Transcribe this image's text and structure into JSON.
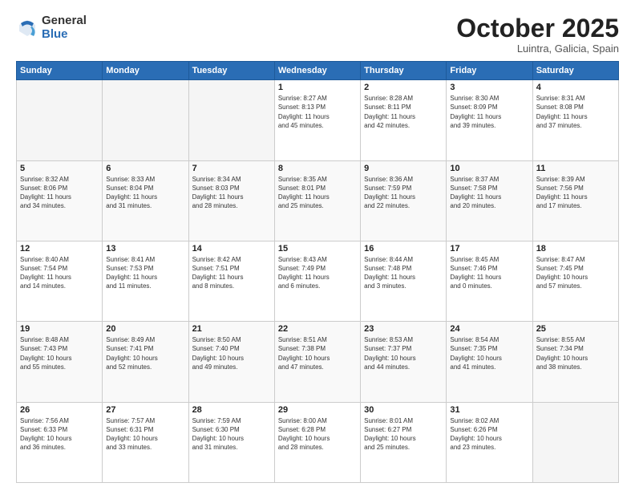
{
  "header": {
    "logo_general": "General",
    "logo_blue": "Blue",
    "month_title": "October 2025",
    "location": "Luintra, Galicia, Spain"
  },
  "weekdays": [
    "Sunday",
    "Monday",
    "Tuesday",
    "Wednesday",
    "Thursday",
    "Friday",
    "Saturday"
  ],
  "weeks": [
    [
      {
        "day": "",
        "info": ""
      },
      {
        "day": "",
        "info": ""
      },
      {
        "day": "",
        "info": ""
      },
      {
        "day": "1",
        "info": "Sunrise: 8:27 AM\nSunset: 8:13 PM\nDaylight: 11 hours\nand 45 minutes."
      },
      {
        "day": "2",
        "info": "Sunrise: 8:28 AM\nSunset: 8:11 PM\nDaylight: 11 hours\nand 42 minutes."
      },
      {
        "day": "3",
        "info": "Sunrise: 8:30 AM\nSunset: 8:09 PM\nDaylight: 11 hours\nand 39 minutes."
      },
      {
        "day": "4",
        "info": "Sunrise: 8:31 AM\nSunset: 8:08 PM\nDaylight: 11 hours\nand 37 minutes."
      }
    ],
    [
      {
        "day": "5",
        "info": "Sunrise: 8:32 AM\nSunset: 8:06 PM\nDaylight: 11 hours\nand 34 minutes."
      },
      {
        "day": "6",
        "info": "Sunrise: 8:33 AM\nSunset: 8:04 PM\nDaylight: 11 hours\nand 31 minutes."
      },
      {
        "day": "7",
        "info": "Sunrise: 8:34 AM\nSunset: 8:03 PM\nDaylight: 11 hours\nand 28 minutes."
      },
      {
        "day": "8",
        "info": "Sunrise: 8:35 AM\nSunset: 8:01 PM\nDaylight: 11 hours\nand 25 minutes."
      },
      {
        "day": "9",
        "info": "Sunrise: 8:36 AM\nSunset: 7:59 PM\nDaylight: 11 hours\nand 22 minutes."
      },
      {
        "day": "10",
        "info": "Sunrise: 8:37 AM\nSunset: 7:58 PM\nDaylight: 11 hours\nand 20 minutes."
      },
      {
        "day": "11",
        "info": "Sunrise: 8:39 AM\nSunset: 7:56 PM\nDaylight: 11 hours\nand 17 minutes."
      }
    ],
    [
      {
        "day": "12",
        "info": "Sunrise: 8:40 AM\nSunset: 7:54 PM\nDaylight: 11 hours\nand 14 minutes."
      },
      {
        "day": "13",
        "info": "Sunrise: 8:41 AM\nSunset: 7:53 PM\nDaylight: 11 hours\nand 11 minutes."
      },
      {
        "day": "14",
        "info": "Sunrise: 8:42 AM\nSunset: 7:51 PM\nDaylight: 11 hours\nand 8 minutes."
      },
      {
        "day": "15",
        "info": "Sunrise: 8:43 AM\nSunset: 7:49 PM\nDaylight: 11 hours\nand 6 minutes."
      },
      {
        "day": "16",
        "info": "Sunrise: 8:44 AM\nSunset: 7:48 PM\nDaylight: 11 hours\nand 3 minutes."
      },
      {
        "day": "17",
        "info": "Sunrise: 8:45 AM\nSunset: 7:46 PM\nDaylight: 11 hours\nand 0 minutes."
      },
      {
        "day": "18",
        "info": "Sunrise: 8:47 AM\nSunset: 7:45 PM\nDaylight: 10 hours\nand 57 minutes."
      }
    ],
    [
      {
        "day": "19",
        "info": "Sunrise: 8:48 AM\nSunset: 7:43 PM\nDaylight: 10 hours\nand 55 minutes."
      },
      {
        "day": "20",
        "info": "Sunrise: 8:49 AM\nSunset: 7:41 PM\nDaylight: 10 hours\nand 52 minutes."
      },
      {
        "day": "21",
        "info": "Sunrise: 8:50 AM\nSunset: 7:40 PM\nDaylight: 10 hours\nand 49 minutes."
      },
      {
        "day": "22",
        "info": "Sunrise: 8:51 AM\nSunset: 7:38 PM\nDaylight: 10 hours\nand 47 minutes."
      },
      {
        "day": "23",
        "info": "Sunrise: 8:53 AM\nSunset: 7:37 PM\nDaylight: 10 hours\nand 44 minutes."
      },
      {
        "day": "24",
        "info": "Sunrise: 8:54 AM\nSunset: 7:35 PM\nDaylight: 10 hours\nand 41 minutes."
      },
      {
        "day": "25",
        "info": "Sunrise: 8:55 AM\nSunset: 7:34 PM\nDaylight: 10 hours\nand 38 minutes."
      }
    ],
    [
      {
        "day": "26",
        "info": "Sunrise: 7:56 AM\nSunset: 6:33 PM\nDaylight: 10 hours\nand 36 minutes."
      },
      {
        "day": "27",
        "info": "Sunrise: 7:57 AM\nSunset: 6:31 PM\nDaylight: 10 hours\nand 33 minutes."
      },
      {
        "day": "28",
        "info": "Sunrise: 7:59 AM\nSunset: 6:30 PM\nDaylight: 10 hours\nand 31 minutes."
      },
      {
        "day": "29",
        "info": "Sunrise: 8:00 AM\nSunset: 6:28 PM\nDaylight: 10 hours\nand 28 minutes."
      },
      {
        "day": "30",
        "info": "Sunrise: 8:01 AM\nSunset: 6:27 PM\nDaylight: 10 hours\nand 25 minutes."
      },
      {
        "day": "31",
        "info": "Sunrise: 8:02 AM\nSunset: 6:26 PM\nDaylight: 10 hours\nand 23 minutes."
      },
      {
        "day": "",
        "info": ""
      }
    ]
  ]
}
